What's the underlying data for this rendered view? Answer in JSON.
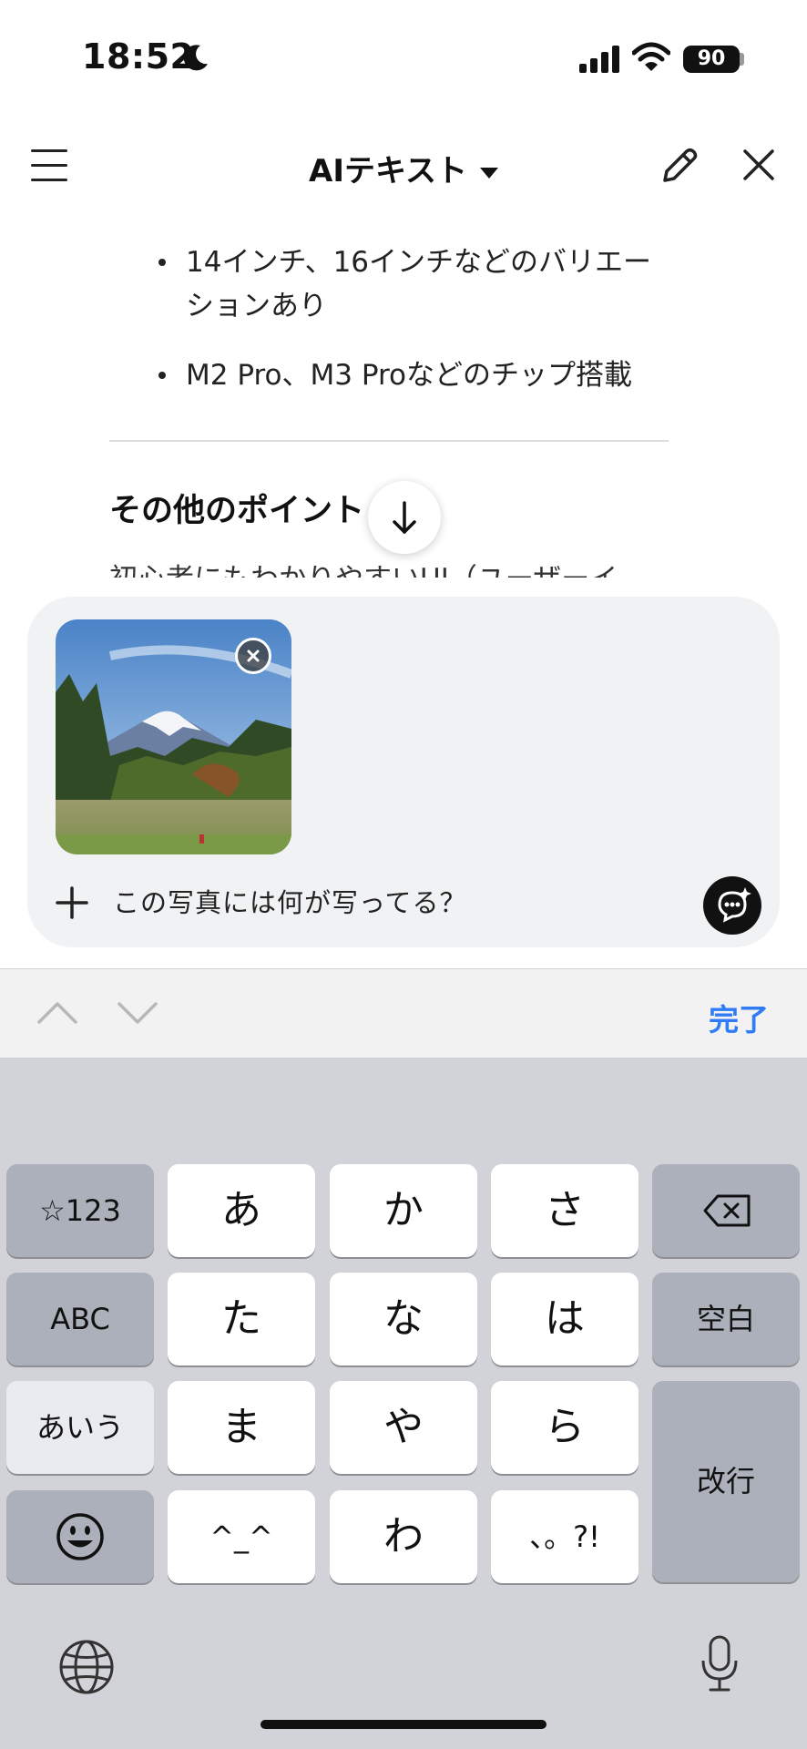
{
  "status_bar": {
    "time": "18:52",
    "battery": "90"
  },
  "header": {
    "title": "AIテキスト"
  },
  "content": {
    "bullets": [
      [
        "14インチ、16インチなどのバリエー",
        "ションあり"
      ],
      [
        "M2 Pro、M3 Proなどのチップ搭載"
      ]
    ],
    "section_heading": "その他のポイント",
    "cut_off_bullet": "初心者にもわかりやすいUI（ユーザーイ"
  },
  "composer": {
    "prompt_text": "この写真には何が写ってる？",
    "attachment": "mountain-photo"
  },
  "toolbar": {
    "done_label": "完了"
  },
  "keyboard": {
    "rows": [
      [
        "☆123",
        "あ",
        "か",
        "さ",
        "⌫"
      ],
      [
        "ABC",
        "た",
        "な",
        "は",
        "空白"
      ],
      [
        "あいう",
        "ま",
        "や",
        "ら",
        "改行"
      ],
      [
        "☺",
        "^_^",
        "わ",
        "、。?!"
      ]
    ],
    "labels": {
      "num": "☆123",
      "a": "あ",
      "ka": "か",
      "sa": "さ",
      "abc": "ABC",
      "ta": "た",
      "na": "な",
      "ha": "は",
      "space": "空白",
      "aiu": "あいう",
      "ma": "ま",
      "ya": "や",
      "ra": "ら",
      "return": "改行",
      "kaomoji": "^_^",
      "wa": "わ",
      "punct": "、。?!"
    }
  },
  "colors": {
    "accent": "#2f7cf6",
    "key_dark": "#abb0bb",
    "keyboard_bg": "#d2d3d8"
  }
}
